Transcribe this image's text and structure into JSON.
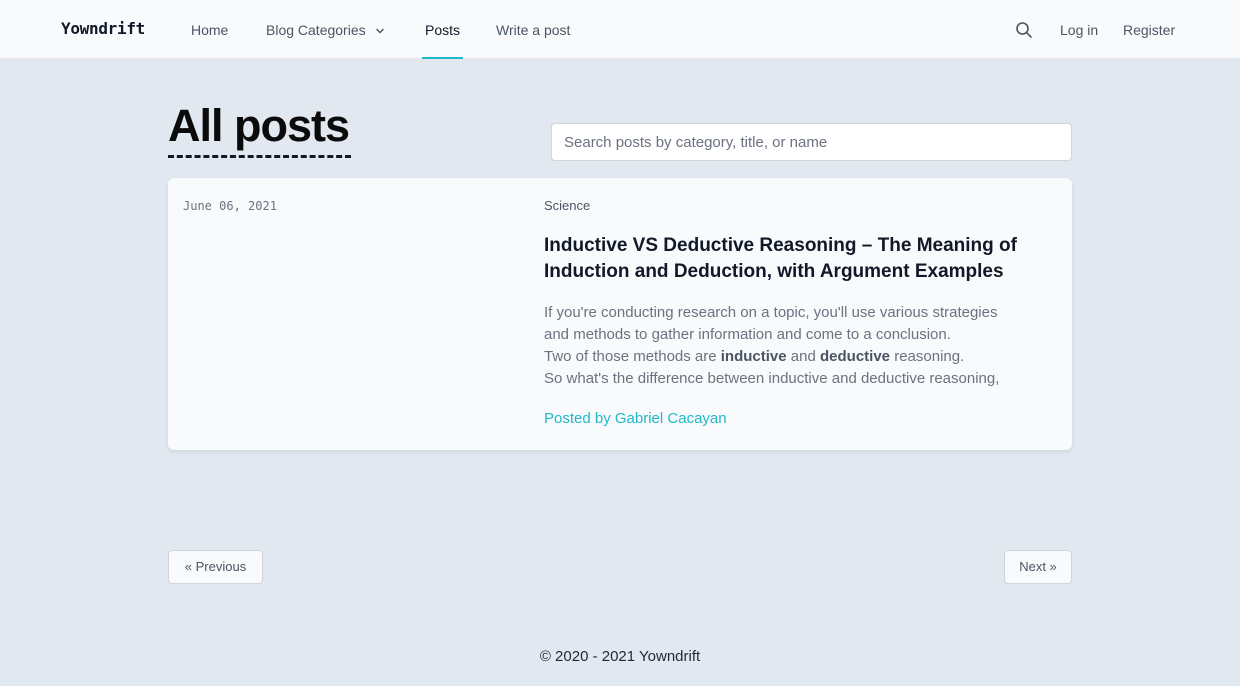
{
  "navbar": {
    "brand": "Yowndrift",
    "links": {
      "home": "Home",
      "categories": "Blog Categories",
      "posts": "Posts",
      "write": "Write a post",
      "login": "Log in",
      "register": "Register"
    },
    "active": "Posts",
    "accent_color": "#22b8c7"
  },
  "page": {
    "title": "All posts",
    "search_placeholder": "Search posts by category, title, or name"
  },
  "posts": [
    {
      "date": "June 06, 2021",
      "category": "Science",
      "title": "Inductive VS Deductive Reasoning – The Meaning of Induction and Deduction, with Argument Examples",
      "excerpt": {
        "line1": "If you're conducting research on a topic, you'll use various strategies",
        "line2": "and methods to gather information and come to a conclusion.",
        "line3_pre": "Two of those methods are ",
        "line3_bold1": "inductive",
        "line3_mid": " and ",
        "line3_bold2": "deductive",
        "line3_post": " reasoning.",
        "line4": "So what's the difference between inductive and deductive reasoning,"
      },
      "author": "Posted by Gabriel Cacayan"
    }
  ],
  "pagination": {
    "previous": "« Previous",
    "next": "Next »"
  },
  "footer": {
    "text": "© 2020 - 2021 Yowndrift"
  },
  "icons": {
    "search": "search-icon",
    "chevron": "chevron-down-icon"
  }
}
